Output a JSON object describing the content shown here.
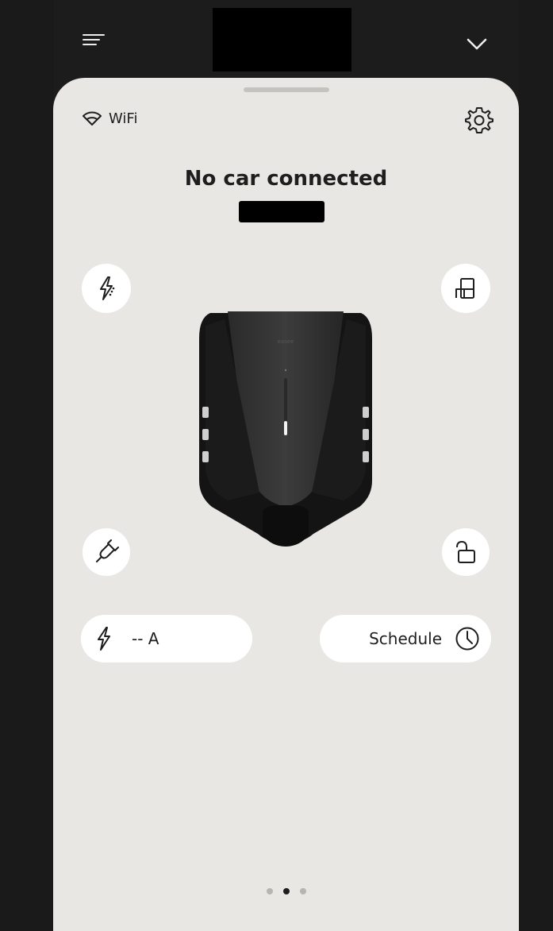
{
  "header": {
    "menu_icon": "menu-icon",
    "collapse_icon": "chevron-down-icon"
  },
  "status": {
    "connection_label": "WiFi",
    "connection_icon": "wifi-icon",
    "settings_icon": "gear-icon",
    "title": "No car connected"
  },
  "controls": {
    "top_left_icon": "lightning-smart-charging-icon",
    "top_right_icon": "installation-layout-icon",
    "bottom_left_icon": "plug-icon",
    "bottom_right_icon": "unlock-icon"
  },
  "current_pill": {
    "icon": "lightning-icon",
    "value": "-- A"
  },
  "schedule_pill": {
    "label": "Schedule",
    "icon": "clock-icon"
  },
  "pagination": {
    "total": 3,
    "active_index": 2
  },
  "colors": {
    "background": "#1c1c1c",
    "card": "#e9e7e3",
    "button": "#ffffff",
    "text": "#1e1e1e"
  }
}
